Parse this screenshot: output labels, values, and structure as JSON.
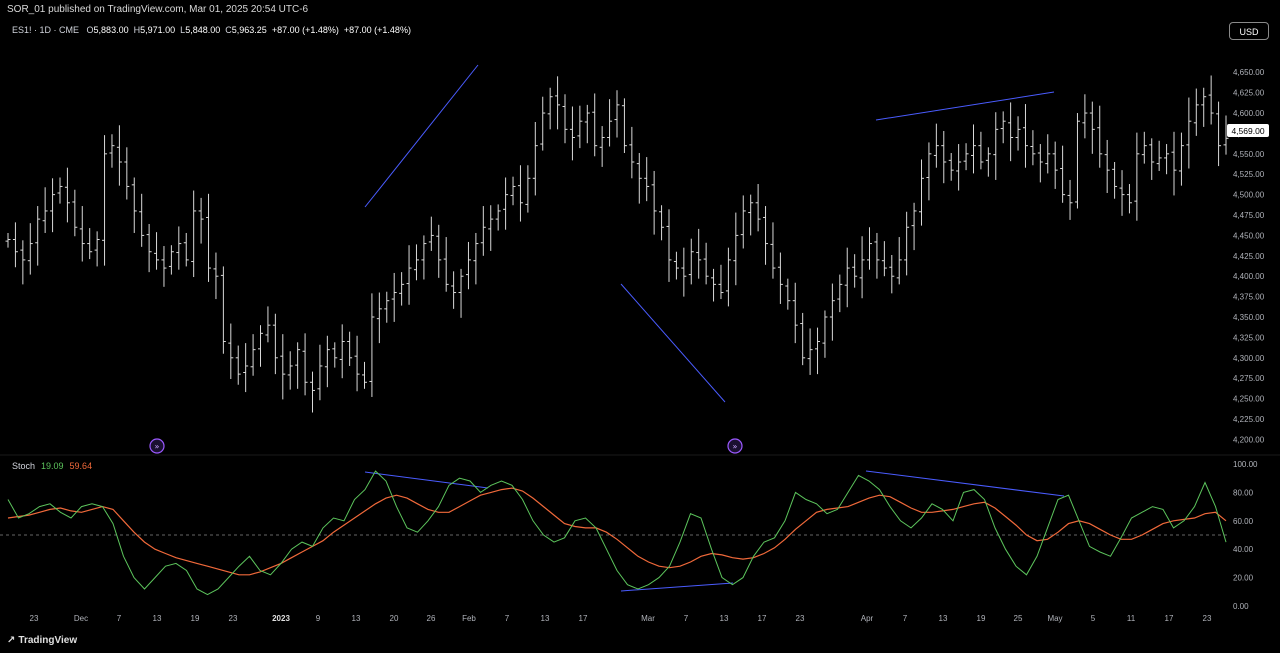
{
  "publisher": "SOR_01 published on TradingView.com, Mar 01, 2025 20:54 UTC-6",
  "symbol": {
    "name": "ES1! · 1D · CME",
    "o_label": "O",
    "o": "5,883.00",
    "h_label": "H",
    "h": "5,971.00",
    "l_label": "L",
    "l": "5,848.00",
    "c_label": "C",
    "c": "5,963.25",
    "change": "+87.00 (+1.48%)",
    "change2": "+87.00 (+1.48%)"
  },
  "currency_button": "USD",
  "last_price_label": "4,569.00",
  "stoch": {
    "label": "Stoch",
    "k_value": "19.09",
    "d_value": "59.64"
  },
  "brand": "TradingView",
  "colors": {
    "k_line": "#5cc45c",
    "d_line": "#f0693a",
    "trendline": "#4a5cff",
    "bars": "#d9d9d9",
    "marker": "#9b59ff"
  },
  "icons": {
    "marker": "arrow-circle-icon",
    "logo": "tradingview-logo-icon"
  },
  "chart_data": [
    {
      "type": "ohlc",
      "ylim": [
        4187,
        4665
      ],
      "price_ticks": [
        "4,650.00",
        "4,625.00",
        "4,600.00",
        "4,575.00",
        "4,550.00",
        "4,525.00",
        "4,500.00",
        "4,475.00",
        "4,450.00",
        "4,425.00",
        "4,400.00",
        "4,375.00",
        "4,350.00",
        "4,325.00",
        "4,300.00",
        "4,275.00",
        "4,250.00",
        "4,225.00",
        "4,200.00"
      ],
      "x_ticks": [
        {
          "label": "23",
          "bold": false
        },
        {
          "label": "Dec",
          "bold": false
        },
        {
          "label": "7",
          "bold": false
        },
        {
          "label": "13",
          "bold": false
        },
        {
          "label": "19",
          "bold": false
        },
        {
          "label": "23",
          "bold": false
        },
        {
          "label": "2023",
          "bold": true
        },
        {
          "label": "9",
          "bold": false
        },
        {
          "label": "13",
          "bold": false
        },
        {
          "label": "20",
          "bold": false
        },
        {
          "label": "26",
          "bold": false
        },
        {
          "label": "Feb",
          "bold": false
        },
        {
          "label": "7",
          "bold": false
        },
        {
          "label": "13",
          "bold": false
        },
        {
          "label": "17",
          "bold": false
        },
        {
          "label": "Mar",
          "bold": false
        },
        {
          "label": "7",
          "bold": false
        },
        {
          "label": "13",
          "bold": false
        },
        {
          "label": "17",
          "bold": false
        },
        {
          "label": "23",
          "bold": false
        },
        {
          "label": "Apr",
          "bold": false
        },
        {
          "label": "7",
          "bold": false
        },
        {
          "label": "13",
          "bold": false
        },
        {
          "label": "19",
          "bold": false
        },
        {
          "label": "25",
          "bold": false
        },
        {
          "label": "May",
          "bold": false
        },
        {
          "label": "5",
          "bold": false
        },
        {
          "label": "11",
          "bold": false
        },
        {
          "label": "17",
          "bold": false
        },
        {
          "label": "23",
          "bold": false
        }
      ],
      "closes": [
        4445,
        4430,
        4420,
        4440,
        4470,
        4480,
        4500,
        4510,
        4490,
        4460,
        4440,
        4430,
        4445,
        4550,
        4560,
        4540,
        4510,
        4480,
        4450,
        4430,
        4420,
        4410,
        4430,
        4440,
        4420,
        4480,
        4470,
        4410,
        4400,
        4320,
        4300,
        4280,
        4290,
        4310,
        4330,
        4340,
        4300,
        4280,
        4290,
        4310,
        4270,
        4260,
        4290,
        4310,
        4300,
        4320,
        4300,
        4280,
        4270,
        4350,
        4360,
        4370,
        4380,
        4390,
        4410,
        4420,
        4440,
        4450,
        4420,
        4390,
        4380,
        4400,
        4420,
        4440,
        4460,
        4470,
        4480,
        4500,
        4510,
        4490,
        4520,
        4560,
        4600,
        4620,
        4610,
        4580,
        4570,
        4590,
        4600,
        4560,
        4570,
        4590,
        4610,
        4560,
        4540,
        4520,
        4510,
        4480,
        4460,
        4420,
        4410,
        4400,
        4430,
        4420,
        4400,
        4390,
        4380,
        4420,
        4450,
        4480,
        4490,
        4470,
        4440,
        4410,
        4390,
        4370,
        4340,
        4300,
        4310,
        4320,
        4350,
        4370,
        4390,
        4410,
        4400,
        4420,
        4440,
        4420,
        4410,
        4400,
        4420,
        4460,
        4480,
        4520,
        4550,
        4560,
        4540,
        4530,
        4540,
        4550,
        4560,
        4540,
        4550,
        4580,
        4590,
        4570,
        4580,
        4560,
        4550,
        4540,
        4550,
        4530,
        4500,
        4490,
        4590,
        4600,
        4580,
        4550,
        4530,
        4510,
        4500,
        4490,
        4550,
        4560,
        4540,
        4545,
        4550,
        4530,
        4560,
        4590,
        4610,
        4620,
        4600,
        4560,
        4569
      ],
      "series": [
        {
          "name": "ES1!"
        }
      ]
    },
    {
      "type": "line",
      "ylim": [
        0,
        100
      ],
      "y_ticks": [
        "100.00",
        "80.00",
        "60.00",
        "40.00",
        "20.00",
        "0.00"
      ],
      "reference_line": 50,
      "series": [
        {
          "name": "%K",
          "values": [
            75,
            62,
            65,
            70,
            72,
            66,
            62,
            70,
            72,
            70,
            58,
            35,
            20,
            12,
            20,
            28,
            30,
            25,
            12,
            8,
            12,
            20,
            28,
            35,
            25,
            22,
            30,
            40,
            45,
            42,
            55,
            62,
            60,
            75,
            82,
            95,
            88,
            70,
            55,
            52,
            60,
            70,
            85,
            90,
            88,
            80,
            85,
            88,
            85,
            75,
            60,
            50,
            45,
            48,
            60,
            62,
            55,
            40,
            25,
            15,
            12,
            15,
            20,
            28,
            45,
            65,
            62,
            40,
            20,
            15,
            20,
            35,
            45,
            48,
            60,
            80,
            75,
            72,
            65,
            68,
            80,
            92,
            88,
            82,
            70,
            60,
            55,
            62,
            72,
            68,
            60,
            80,
            82,
            75,
            55,
            40,
            28,
            22,
            35,
            55,
            75,
            78,
            60,
            42,
            38,
            35,
            48,
            62,
            66,
            70,
            68,
            55,
            60,
            70,
            87,
            70,
            45
          ]
        },
        {
          "name": "%D",
          "values": [
            62,
            63,
            64,
            66,
            68,
            69,
            67,
            66,
            68,
            70,
            68,
            60,
            52,
            45,
            40,
            37,
            34,
            32,
            30,
            28,
            26,
            24,
            22,
            22,
            24,
            27,
            30,
            34,
            38,
            42,
            46,
            52,
            57,
            62,
            67,
            72,
            76,
            78,
            76,
            72,
            68,
            66,
            66,
            70,
            74,
            78,
            80,
            82,
            83,
            81,
            76,
            70,
            64,
            58,
            56,
            55,
            55,
            52,
            47,
            41,
            35,
            31,
            28,
            27,
            28,
            31,
            35,
            37,
            36,
            34,
            33,
            34,
            37,
            41,
            47,
            54,
            60,
            66,
            68,
            69,
            70,
            73,
            76,
            78,
            77,
            73,
            69,
            66,
            66,
            67,
            68,
            70,
            72,
            73,
            69,
            63,
            57,
            50,
            46,
            47,
            52,
            58,
            60,
            58,
            54,
            50,
            47,
            47,
            50,
            54,
            58,
            60,
            61,
            62,
            65,
            66,
            60
          ]
        }
      ]
    }
  ]
}
